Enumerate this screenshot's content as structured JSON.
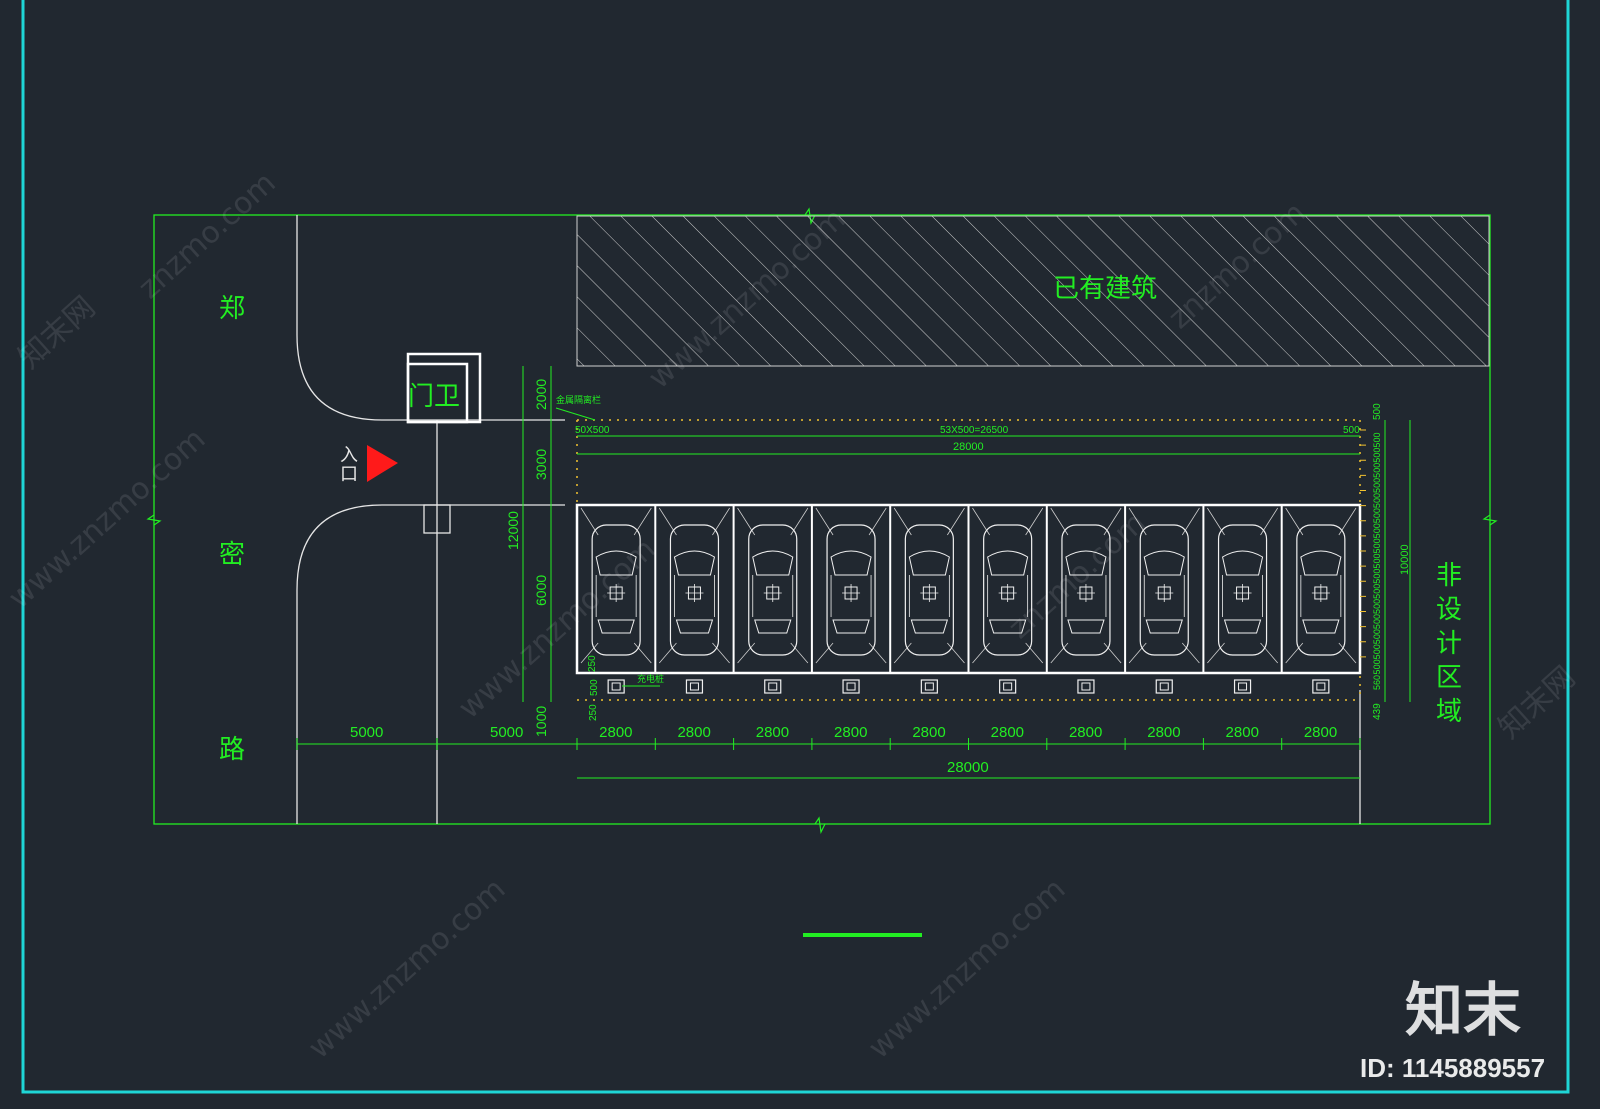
{
  "labels": {
    "road_char_1": "郑",
    "road_char_2": "密",
    "road_char_3": "路",
    "existing_building": "已有建筑",
    "guard_house": "门卫",
    "entrance_1": "入",
    "entrance_2": "口",
    "non_design_1": "非",
    "non_design_2": "设",
    "non_design_3": "计",
    "non_design_4": "区",
    "non_design_5": "域",
    "fence_note": "金属隔离栏",
    "pile_note": "充电桩"
  },
  "dimensions": {
    "left_5000_a": "5000",
    "left_5000_b": "5000",
    "bay_width": "2800",
    "total_bottom": "28000",
    "top_pattern": "53X500=26500",
    "top_total": "28000",
    "top_small_left": "50X500",
    "top_small_right": "500",
    "vert_2000": "2000",
    "vert_3000": "3000",
    "vert_12000": "12000",
    "vert_6000": "6000",
    "vert_1000": "1000",
    "small_250": "250",
    "small_500": "500",
    "small_250b": "250",
    "right_500": "500",
    "right_10000": "10000",
    "right_439": "439",
    "right_5600": "560"
  },
  "parking_bays": 10,
  "right_ticks": [
    "500",
    "500",
    "500",
    "500",
    "500",
    "500",
    "500",
    "500",
    "500",
    "500",
    "500",
    "500",
    "500",
    "500",
    "500",
    "500"
  ],
  "watermark": {
    "site": "znzmo.com",
    "www": "www.znzmo.com",
    "brand_cn": "知末网",
    "logo_cn": "知末",
    "id": "ID: 1145889557"
  },
  "colors": {
    "background": "#212830",
    "border": "#1fd6d6",
    "cad_green": "#22ee22",
    "line_white": "#e6e6e6",
    "hatch": "#d0d0d0",
    "entrance_red": "#ff1a1a",
    "dot_yellow": "#f2c230"
  }
}
